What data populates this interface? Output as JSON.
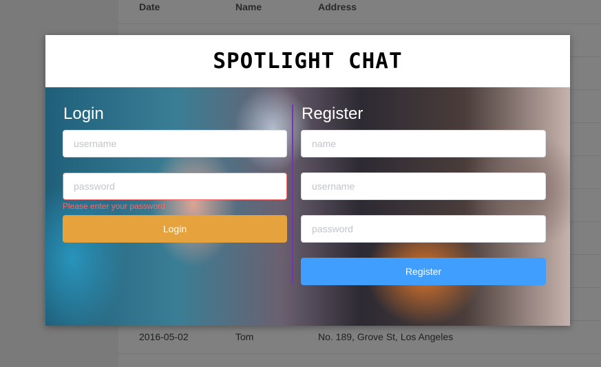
{
  "background_table": {
    "headers": [
      "Date",
      "Name",
      "Address"
    ],
    "visible_row": {
      "date": "2016-05-02",
      "name": "Tom",
      "address": "No. 189, Grove St, Los Angeles"
    }
  },
  "modal": {
    "title": "SPOTLIGHT CHAT",
    "login": {
      "heading": "Login",
      "username_placeholder": "username",
      "password_placeholder": "password",
      "password_error": "Please enter your password",
      "button_label": "Login"
    },
    "register": {
      "heading": "Register",
      "name_placeholder": "name",
      "username_placeholder": "username",
      "password_placeholder": "password",
      "button_label": "Register"
    }
  },
  "colors": {
    "login_button": "#e6a23c",
    "register_button": "#409eff",
    "error": "#f56c6c",
    "divider": "#7b2fbf"
  }
}
